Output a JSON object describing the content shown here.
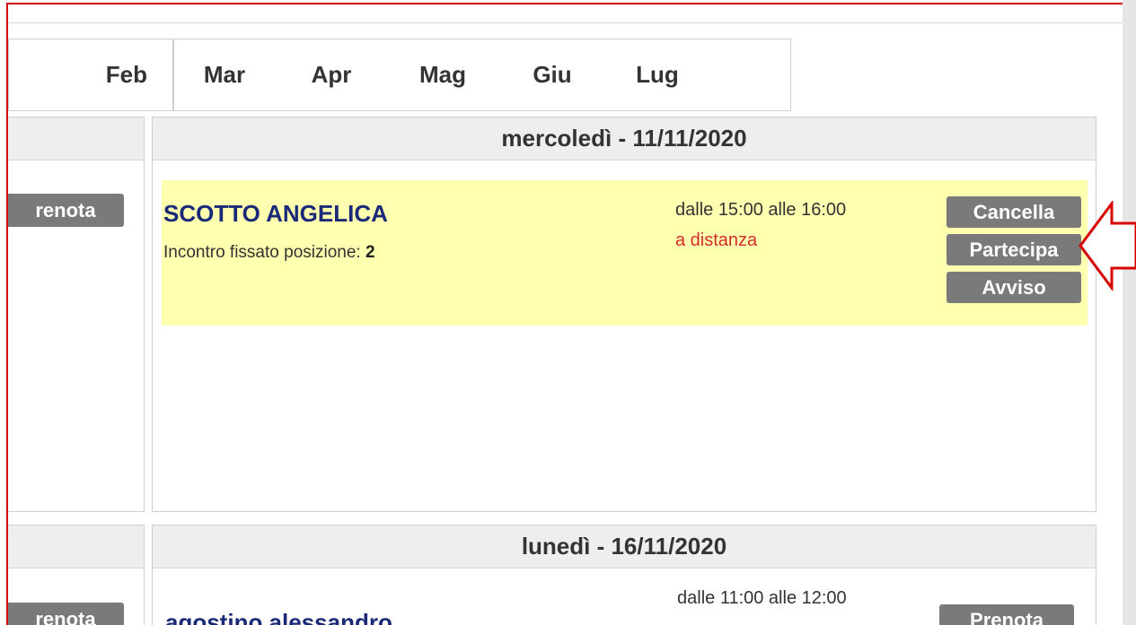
{
  "tabs": [
    "Feb",
    "Mar",
    "Apr",
    "Mag",
    "Giu",
    "Lug"
  ],
  "left_buttons": [
    "renota",
    "renota"
  ],
  "days": [
    {
      "header": "mercoledì - 11/11/2020",
      "appointment": {
        "name": "SCOTTO ANGELICA",
        "detail_label": "Incontro fissato posizione:",
        "detail_value": "2",
        "time": "dalle 15:00 alle 16:00",
        "mode": "a distanza",
        "buttons": [
          "Cancella",
          "Partecipa",
          "Avviso"
        ]
      }
    },
    {
      "header": "lunedì - 16/11/2020",
      "appointment": {
        "name": "agostino alessandro",
        "time": "dalle 11:00 alle 12:00",
        "buttons": [
          "Prenota"
        ]
      }
    }
  ],
  "colors": {
    "frame_border": "#d60000",
    "arrow": "#d60000",
    "highlight": "#ffffb0",
    "name": "#1b2a78",
    "mode": "#d32b2b",
    "button": "#7a7a7a"
  },
  "annotation": "arrow-pointing-left-icon"
}
